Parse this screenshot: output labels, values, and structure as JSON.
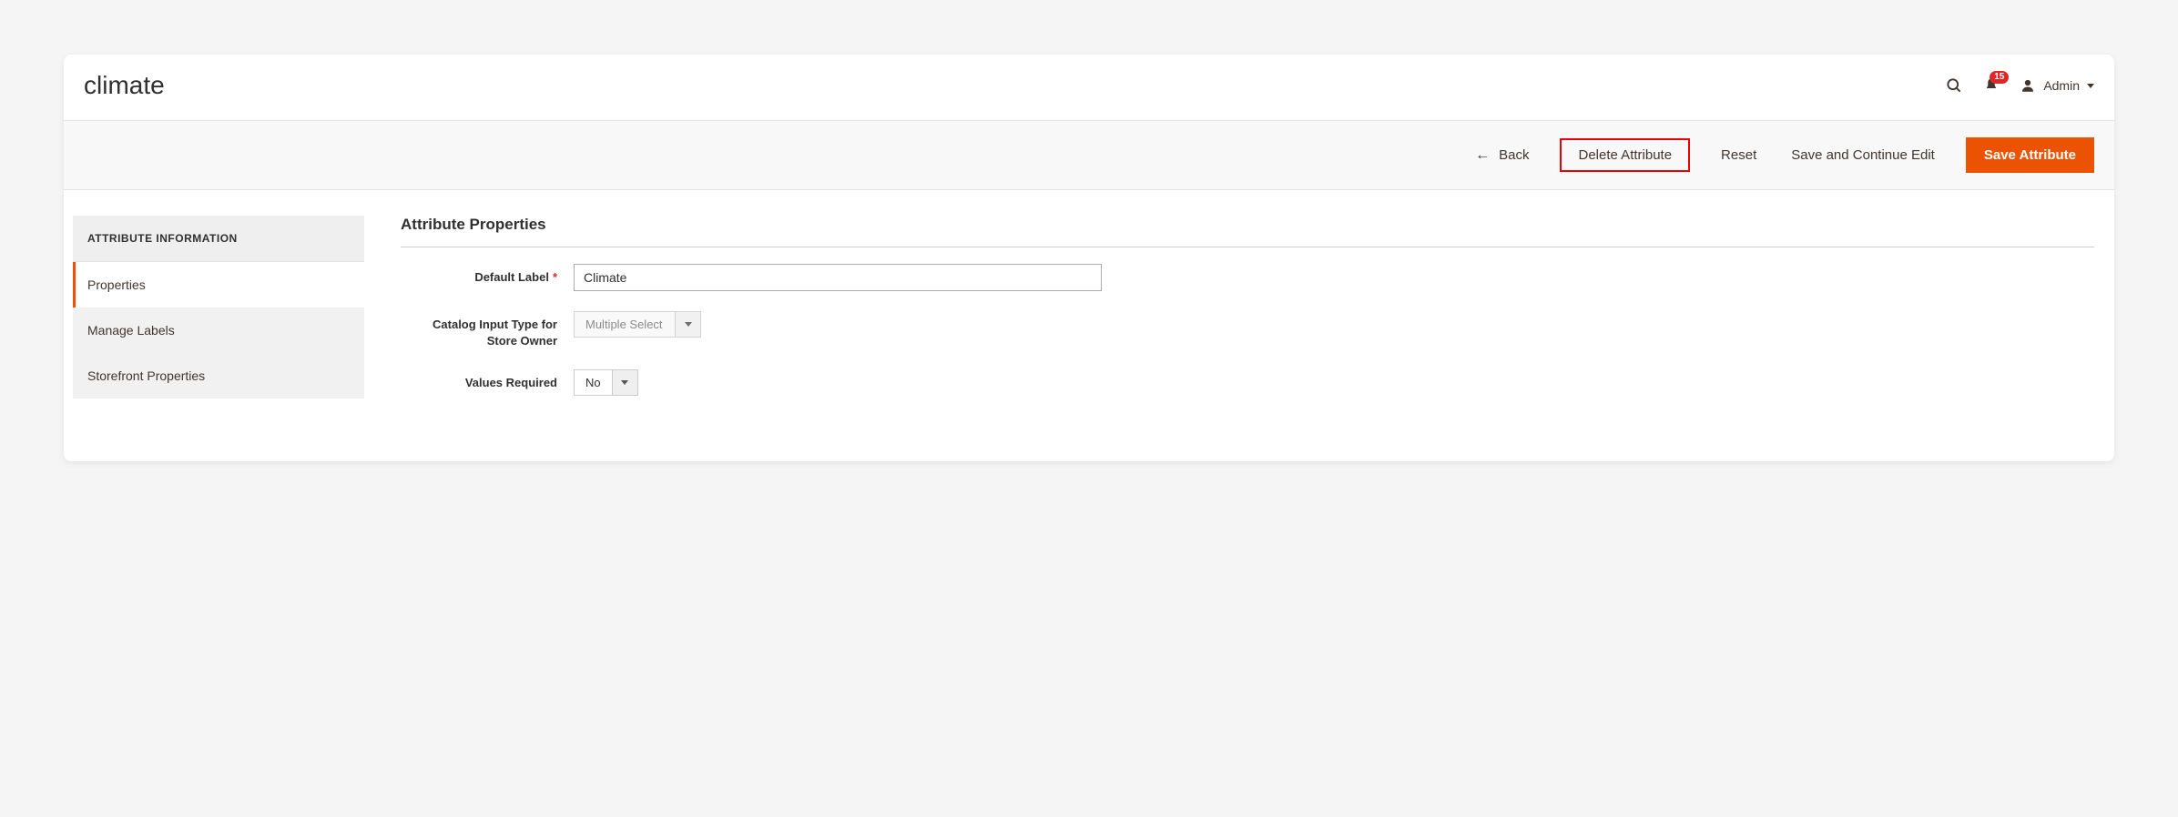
{
  "header": {
    "title": "climate",
    "notification_count": "15",
    "admin_label": "Admin"
  },
  "toolbar": {
    "back_label": "Back",
    "delete_label": "Delete Attribute",
    "reset_label": "Reset",
    "save_continue_label": "Save and Continue Edit",
    "save_label": "Save Attribute"
  },
  "sidebar": {
    "heading": "ATTRIBUTE INFORMATION",
    "items": [
      {
        "label": "Properties"
      },
      {
        "label": "Manage Labels"
      },
      {
        "label": "Storefront Properties"
      }
    ]
  },
  "main": {
    "section_title": "Attribute Properties",
    "fields": {
      "default_label": {
        "label": "Default Label",
        "value": "Climate"
      },
      "input_type": {
        "label": "Catalog Input Type for Store Owner",
        "value": "Multiple Select"
      },
      "values_required": {
        "label": "Values Required",
        "value": "No"
      }
    }
  }
}
